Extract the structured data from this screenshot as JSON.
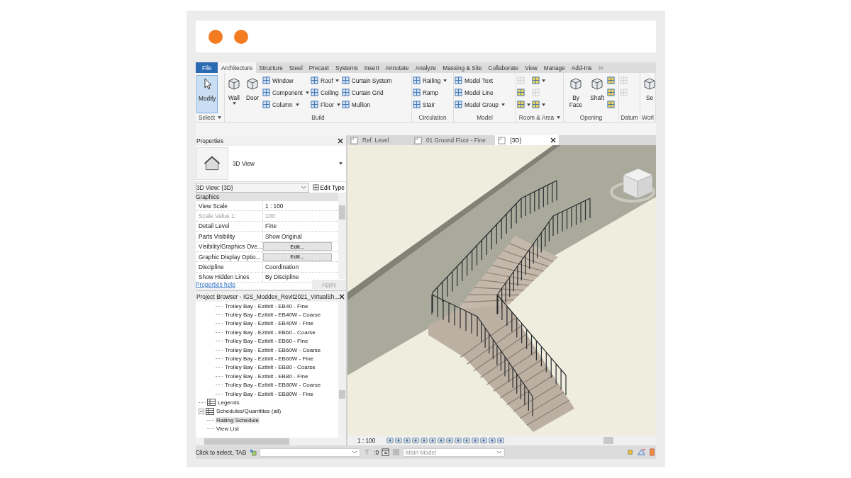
{
  "ribbon": {
    "tabs": [
      {
        "label": "File",
        "kind": "file",
        "selected": false
      },
      {
        "label": "Architecture",
        "kind": "tab",
        "selected": true
      },
      {
        "label": "Structure",
        "kind": "tab",
        "selected": false
      },
      {
        "label": "Steel",
        "kind": "tab",
        "selected": false
      },
      {
        "label": "Precast",
        "kind": "tab",
        "selected": false
      },
      {
        "label": "Systems",
        "kind": "tab",
        "selected": false
      },
      {
        "label": "Insert",
        "kind": "tab",
        "selected": false
      },
      {
        "label": "Annotate",
        "kind": "tab",
        "selected": false
      },
      {
        "label": "Analyze",
        "kind": "tab",
        "selected": false
      },
      {
        "label": "Massing & Site",
        "kind": "tab",
        "selected": false
      },
      {
        "label": "Collaborate",
        "kind": "tab",
        "selected": false
      },
      {
        "label": "View",
        "kind": "tab",
        "selected": false
      },
      {
        "label": "Manage",
        "kind": "tab",
        "selected": false
      },
      {
        "label": "Add-Ins",
        "kind": "tab",
        "selected": false
      }
    ],
    "panels": [
      {
        "title": "Select",
        "menu": true,
        "items": [
          {
            "kind": "pointer",
            "label": "Modify",
            "selected": true,
            "dropdown": false
          }
        ]
      },
      {
        "title": "Build",
        "menu": false,
        "items": [
          {
            "kind": "large",
            "label": "Wall",
            "selected": false,
            "dropdown": true
          },
          {
            "kind": "large",
            "label": "Door",
            "selected": false,
            "dropdown": false
          },
          {
            "kind": "stack",
            "items": [
              {
                "label": "Window",
                "dropdown": false
              },
              {
                "label": "Component",
                "dropdown": true
              },
              {
                "label": "Column",
                "dropdown": true
              }
            ]
          },
          {
            "kind": "stack",
            "items": [
              {
                "label": "Roof",
                "dropdown": true
              },
              {
                "label": "Ceiling",
                "dropdown": false
              },
              {
                "label": "Floor",
                "dropdown": true
              }
            ]
          },
          {
            "kind": "stack",
            "items": [
              {
                "label": "Curtain System",
                "dropdown": false
              },
              {
                "label": "Curtain Grid",
                "dropdown": false
              },
              {
                "label": "Mullion",
                "dropdown": false
              }
            ]
          }
        ]
      },
      {
        "title": "Circulation",
        "menu": false,
        "items": [
          {
            "kind": "stack",
            "items": [
              {
                "label": "Railing",
                "dropdown": true
              },
              {
                "label": "Ramp",
                "dropdown": false
              },
              {
                "label": "Stair",
                "dropdown": false
              }
            ]
          }
        ]
      },
      {
        "title": "Model",
        "menu": false,
        "items": [
          {
            "kind": "stack",
            "items": [
              {
                "label": "Model Text",
                "dropdown": false
              },
              {
                "label": "Model Line",
                "dropdown": false
              },
              {
                "label": "Model Group",
                "dropdown": true
              }
            ]
          }
        ]
      },
      {
        "title": "Room & Area",
        "menu": true,
        "items": [
          {
            "kind": "iconstack",
            "items": [
              {
                "disabled": true,
                "dropdown": false
              },
              {
                "disabled": false,
                "dropdown": false
              },
              {
                "disabled": false,
                "dropdown": true
              }
            ]
          },
          {
            "kind": "iconstack",
            "items": [
              {
                "disabled": false,
                "dropdown": true
              },
              {
                "disabled": true,
                "dropdown": false
              },
              {
                "disabled": false,
                "dropdown": true
              }
            ]
          }
        ]
      },
      {
        "title": "Opening",
        "menu": false,
        "items": [
          {
            "kind": "large",
            "label": "By Face",
            "selected": false,
            "dropdown": false
          },
          {
            "kind": "large",
            "label": "Shaft",
            "selected": false,
            "dropdown": false
          },
          {
            "kind": "iconstack",
            "items": [
              {
                "disabled": false,
                "dropdown": false
              },
              {
                "disabled": false,
                "dropdown": false
              },
              {
                "disabled": false,
                "dropdown": false
              }
            ]
          }
        ]
      },
      {
        "title": "Datum",
        "menu": false,
        "items": [
          {
            "kind": "iconstack",
            "items": [
              {
                "disabled": true,
                "dropdown": false
              },
              {
                "disabled": true,
                "dropdown": false
              }
            ]
          }
        ]
      },
      {
        "title": "Worl",
        "menu": false,
        "items": [
          {
            "kind": "large",
            "label": "Se",
            "selected": false,
            "dropdown": false
          }
        ]
      }
    ]
  },
  "properties": {
    "title": "Properties",
    "type_name": "3D View",
    "selector": "3D View: {3D}",
    "edit_type": "Edit Type",
    "group": "Graphics",
    "rows": [
      {
        "name": "View Scale",
        "value": "1 : 100",
        "kind": "text",
        "disabled": false
      },
      {
        "name": "Scale Value    1:",
        "value": "100",
        "kind": "text",
        "disabled": true
      },
      {
        "name": "Detail Level",
        "value": "Fine",
        "kind": "text",
        "disabled": false
      },
      {
        "name": "Parts Visibility",
        "value": "Show Original",
        "kind": "text",
        "disabled": false
      },
      {
        "name": "Visibility/Graphics Ove...",
        "value": "Edit...",
        "kind": "button",
        "disabled": false
      },
      {
        "name": "Graphic Display Optio...",
        "value": "Edit...",
        "kind": "button",
        "disabled": false
      },
      {
        "name": "Discipline",
        "value": "Coordination",
        "kind": "text",
        "disabled": false
      },
      {
        "name": "Show Hidden Lines",
        "value": "By Discipline",
        "kind": "text",
        "disabled": false
      }
    ],
    "help_link": "Properties help",
    "apply": {
      "label": "Apply",
      "disabled": true
    }
  },
  "project_browser": {
    "title": "Project Browser - IGS_Moddex_Revit2021_VirtualSh...",
    "tree": [
      {
        "children": [
          {
            "children": [
              {
                "label": "Trolley Bay - Ezibilt - EB40 - Fine",
                "selected": false
              },
              {
                "label": "Trolley Bay - Ezibilt - EB40W - Coarse",
                "selected": false
              },
              {
                "label": "Trolley Bay - Ezibilt - EB40W - Fine",
                "selected": false
              },
              {
                "label": "Trolley Bay - Ezibilt - EB60 - Coarse",
                "selected": false
              },
              {
                "label": "Trolley Bay - Ezibilt - EB60 - Fine",
                "selected": false
              },
              {
                "label": "Trolley Bay - Ezibilt - EB60W - Coarse",
                "selected": false
              },
              {
                "label": "Trolley Bay - Ezibilt - EB60W - Fine",
                "selected": false
              },
              {
                "label": "Trolley Bay - Ezibilt - EB80 - Coarse",
                "selected": false
              },
              {
                "label": "Trolley Bay - Ezibilt - EB80 - Fine",
                "selected": false
              },
              {
                "label": "Trolley Bay - Ezibilt - EB80W - Coarse",
                "selected": false
              },
              {
                "label": "Trolley Bay - Ezibilt - EB80W - Fine",
                "selected": false
              }
            ]
          }
        ]
      },
      {
        "label": "Legends",
        "kind": "category",
        "selected": false
      },
      {
        "label": "Schedules/Quantities (all)",
        "kind": "category",
        "selected": false,
        "expanded": true,
        "children": [
          {
            "label": "Railing Schedule",
            "selected": true
          },
          {
            "label": "View List",
            "selected": false
          }
        ]
      }
    ]
  },
  "view_tabs": [
    {
      "label": "Ref. Level",
      "selected": false
    },
    {
      "label": "01 Ground Floor - Fine",
      "selected": false
    },
    {
      "label": "{3D}",
      "selected": true
    }
  ],
  "view_bar": {
    "scale": "1 : 100"
  },
  "status_bar": {
    "prompt": "Click to select, TAB",
    "count": ":0",
    "model": {
      "value": "Main Model",
      "disabled": true
    }
  }
}
